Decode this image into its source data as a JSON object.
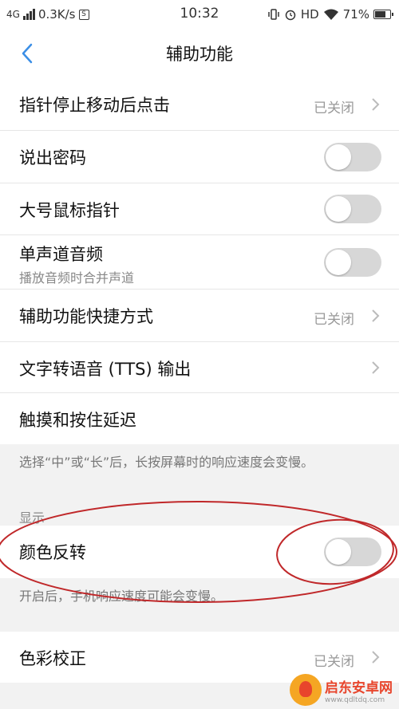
{
  "status_bar": {
    "network_type": "4G",
    "speed": "0.3K/s",
    "data_icon": "S",
    "time": "10:32",
    "hd": "HD",
    "battery": "71%"
  },
  "header": {
    "title": "辅助功能"
  },
  "rows": [
    {
      "label": "指针停止移动后点击",
      "value": "已关闭"
    },
    {
      "label": "说出密码",
      "toggle": "off"
    },
    {
      "label": "大号鼠标指针",
      "toggle": "off"
    },
    {
      "label": "单声道音频",
      "sub": "播放音频时合并声道",
      "toggle": "off"
    },
    {
      "label": "辅助功能快捷方式",
      "value": "已关闭"
    },
    {
      "label": "文字转语音 (TTS) 输出"
    },
    {
      "label": "触摸和按住延迟"
    }
  ],
  "notes": {
    "touch_delay": "选择“中”或“长”后，长按屏幕时的响应速度会变慢。",
    "invert": "开启后，手机响应速度可能会变慢。"
  },
  "display_section": {
    "header": "显示",
    "color_inversion": {
      "label": "颜色反转",
      "toggle": "off"
    },
    "color_correction": {
      "label": "色彩校正",
      "value": "已关闭"
    }
  },
  "watermark": {
    "text": "启东安卓网",
    "url": "www.qdltdq.com"
  },
  "colors": {
    "accent": "#3a8ee6",
    "annotation": "#c0282a",
    "toggle_off": "#d7d7d7"
  },
  "icons": [
    "back-arrow-icon",
    "chevron-right-icon",
    "signal-icon",
    "wifi-icon",
    "vibrate-icon",
    "alarm-icon",
    "battery-icon"
  ]
}
